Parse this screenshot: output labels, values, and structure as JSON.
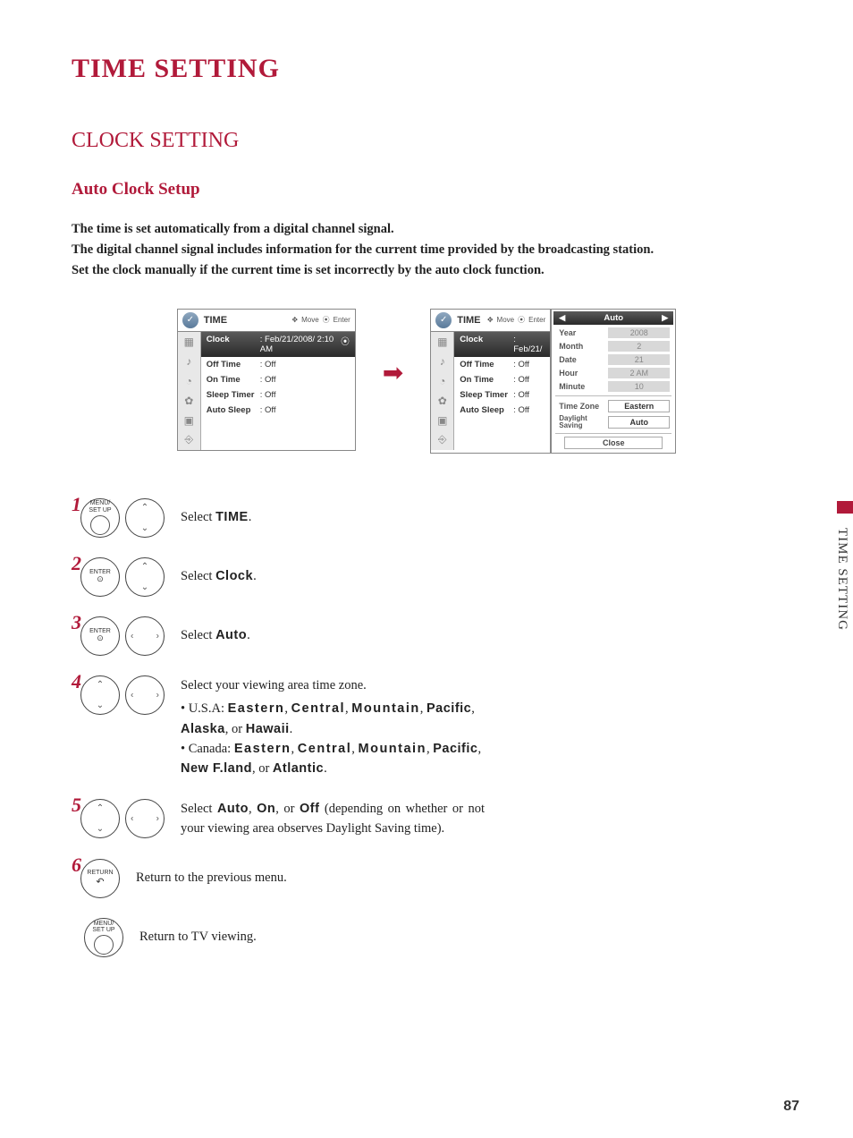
{
  "title_main": "TIME SETTING",
  "title_section": "CLOCK SETTING",
  "title_sub": "Auto Clock Setup",
  "intro": {
    "p1": "The time is set automatically from a digital channel signal.",
    "p2": "The digital channel signal includes information for the current time provided by the broadcasting station.",
    "p3": "Set the clock manually if the current time is set incorrectly by the auto clock function."
  },
  "osd": {
    "title": "TIME",
    "nav_move": "Move",
    "nav_enter": "Enter",
    "rows": [
      {
        "label": "Clock",
        "value": "Feb/21/2008/  2:10 AM"
      },
      {
        "label": "Off Time",
        "value": "Off"
      },
      {
        "label": "On Time",
        "value": "Off"
      },
      {
        "label": "Sleep Timer",
        "value": "Off"
      },
      {
        "label": "Auto Sleep",
        "value": "Off"
      }
    ],
    "rows_right_clock_value": "Feb/21/",
    "detail": {
      "auto": "Auto",
      "fields": [
        {
          "label": "Year",
          "value": "2008"
        },
        {
          "label": "Month",
          "value": "2"
        },
        {
          "label": "Date",
          "value": "21"
        },
        {
          "label": "Hour",
          "value": "2 AM"
        },
        {
          "label": "Minute",
          "value": "10"
        }
      ],
      "timezone_label": "Time Zone",
      "timezone_value": "Eastern",
      "ds_label": "Daylight Saving",
      "ds_value": "Auto",
      "close": "Close"
    }
  },
  "buttons": {
    "menu": "MENU/\nSET UP",
    "enter": "ENTER",
    "return": "RETURN"
  },
  "steps": {
    "s1": {
      "prefix": "Select ",
      "bold": "TIME",
      "suffix": "."
    },
    "s2": {
      "prefix": "Select ",
      "bold": "Clock",
      "suffix": "."
    },
    "s3": {
      "prefix": "Select ",
      "bold": "Auto",
      "suffix": "."
    },
    "s4": {
      "line1": "Select your viewing area time zone.",
      "usa_pre": "U.S.A: ",
      "usa_b1": "Eastern",
      "usa_b2": "Central",
      "usa_b3": "Mountain",
      "usa_b4": "Pacific",
      "usa_b5": "Alaska",
      "usa_b6": "Hawaii",
      "can_pre": "Canada: ",
      "can_b1": "Eastern",
      "can_b2": "Central",
      "can_b3": "Mountain",
      "can_b4": "Pacific",
      "can_b5": "New F.land",
      "can_b6": "Atlantic"
    },
    "s5": {
      "pre": "Select ",
      "b1": "Auto",
      "b2": "On",
      "b3": "Off",
      "post": " (depending on whether or not your viewing area observes Daylight Saving time)."
    },
    "s6": "Return to the previous menu.",
    "s7": "Return to TV viewing."
  },
  "side_tab": "TIME SETTING",
  "page_num": "87",
  "zones_or": ", or ",
  "comma_sep": ", "
}
